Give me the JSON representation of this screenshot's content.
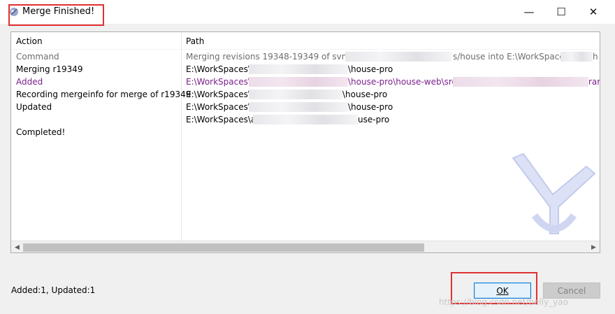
{
  "window": {
    "title": "Merge Finished!",
    "controls": {
      "minimize": "—",
      "maximize": "☐",
      "close": "✕"
    }
  },
  "table": {
    "columns": {
      "action": "Action",
      "path": "Path"
    },
    "rows": [
      {
        "action": "Command",
        "path": "Merging revisions 19348-19349 of svn:/",
        "path_tail": "s/house into E:\\WorkSpaces",
        "path_tail2": "h",
        "style": "gray"
      },
      {
        "action": "Merging r19349",
        "path": "E:\\WorkSpaces\\",
        "path_tail": "\\house-pro",
        "style": "normal"
      },
      {
        "action": "Added",
        "path": "E:\\WorkSpaces\\",
        "path_tail": "\\house-pro\\house-web\\src\\",
        "path_tail2": "rar",
        "style": "purple"
      },
      {
        "action": "Recording mergeinfo for merge of r19349",
        "path": "E:\\WorkSpaces\\",
        "path_tail": "\\house-pro",
        "style": "normal"
      },
      {
        "action": "Updated",
        "path": "E:\\WorkSpaces\\",
        "path_tail": "\\house-pro",
        "style": "normal"
      },
      {
        "action": "",
        "path": "E:\\WorkSpaces\\a",
        "path_tail": "use-pro",
        "style": "normal"
      },
      {
        "action": "Completed!",
        "path": "",
        "path_tail": "",
        "style": "normal"
      }
    ]
  },
  "status_text": "Added:1, Updated:1",
  "buttons": {
    "ok": "OK",
    "cancel": "Cancel"
  },
  "credit_text": "https://blog.csdn.net/belly_yao",
  "colors": {
    "highlight": "#e03030",
    "added": "#7a1f8a",
    "accent": "#0078d7"
  }
}
